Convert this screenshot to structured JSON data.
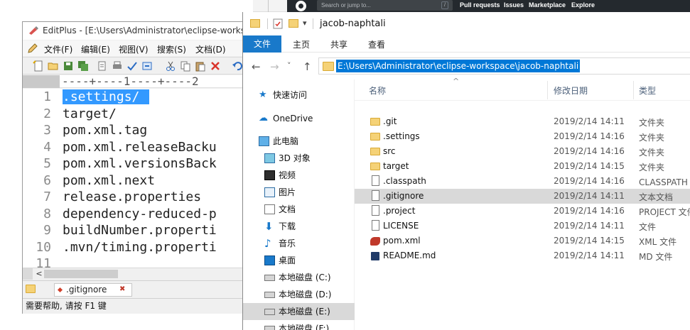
{
  "github": {
    "search_placeholder": "Search or jump to...",
    "slash_key": "/",
    "nav": [
      "Pull requests",
      "Issues",
      "Marketplace",
      "Explore"
    ]
  },
  "editplus": {
    "title": "EditPlus - [E:\\Users\\Administrator\\eclipse-worksp",
    "menu": [
      "文件(F)",
      "编辑(E)",
      "视图(V)",
      "搜索(S)",
      "文档(D)"
    ],
    "ruler": "----+----1----+----2",
    "lines": [
      {
        "num": "1",
        "text": ".settings/",
        "selected": true
      },
      {
        "num": "2",
        "text": "target/"
      },
      {
        "num": "3",
        "text": "pom.xml.tag"
      },
      {
        "num": "4",
        "text": "pom.xml.releaseBacku"
      },
      {
        "num": "5",
        "text": "pom.xml.versionsBack"
      },
      {
        "num": "6",
        "text": "pom.xml.next"
      },
      {
        "num": "7",
        "text": "release.properties"
      },
      {
        "num": "8",
        "text": "dependency-reduced-p"
      },
      {
        "num": "9",
        "text": "buildNumber.properti"
      },
      {
        "num": "10",
        "text": ".mvn/timing.properti"
      },
      {
        "num": "11",
        "text": ""
      }
    ],
    "scroll_left": "<",
    "tab_label": ".gitignore",
    "status": "需要帮助, 请按 F1 键"
  },
  "explorer": {
    "title": "jacob-naphtali",
    "ribbon": {
      "file": "文件",
      "tabs": [
        "主页",
        "共享",
        "查看"
      ]
    },
    "nav_buttons": [
      "←",
      "→",
      "˅",
      "↑"
    ],
    "address": "E:\\Users\\Administrator\\eclipse-workspace\\jacob-naphtali",
    "sidebar": [
      {
        "label": "快速访问",
        "icon": "star-icon"
      },
      {
        "label": "OneDrive",
        "icon": "cloud-icon"
      },
      {
        "label": "此电脑",
        "icon": "computer-icon"
      },
      {
        "label": "3D 对象",
        "icon": "cube-icon"
      },
      {
        "label": "视频",
        "icon": "video-icon"
      },
      {
        "label": "图片",
        "icon": "picture-icon"
      },
      {
        "label": "文档",
        "icon": "document-icon"
      },
      {
        "label": "下载",
        "icon": "download-icon"
      },
      {
        "label": "音乐",
        "icon": "music-icon"
      },
      {
        "label": "桌面",
        "icon": "desktop-icon"
      },
      {
        "label": "本地磁盘 (C:)",
        "icon": "drive-icon"
      },
      {
        "label": "本地磁盘 (D:)",
        "icon": "drive-icon"
      },
      {
        "label": "本地磁盘 (E:)",
        "icon": "drive-icon"
      },
      {
        "label": "本地磁盘 (F:)",
        "icon": "drive-icon"
      }
    ],
    "columns": {
      "name": "名称",
      "date": "修改日期",
      "type": "类型"
    },
    "files": [
      {
        "name": ".git",
        "date": "2019/2/14 14:11",
        "type": "文件夹",
        "icon": "folder-icon"
      },
      {
        "name": ".settings",
        "date": "2019/2/14 14:16",
        "type": "文件夹",
        "icon": "folder-icon"
      },
      {
        "name": "src",
        "date": "2019/2/14 14:16",
        "type": "文件夹",
        "icon": "folder-icon"
      },
      {
        "name": "target",
        "date": "2019/2/14 14:15",
        "type": "文件夹",
        "icon": "folder-icon"
      },
      {
        "name": ".classpath",
        "date": "2019/2/14 14:16",
        "type": "CLASSPATH 文",
        "icon": "file-icon"
      },
      {
        "name": ".gitignore",
        "date": "2019/2/14 14:11",
        "type": "文本文档",
        "icon": "file-icon",
        "selected": true
      },
      {
        "name": ".project",
        "date": "2019/2/14 14:16",
        "type": "PROJECT 文件",
        "icon": "file-icon"
      },
      {
        "name": "LICENSE",
        "date": "2019/2/14 14:11",
        "type": "文件",
        "icon": "file-icon"
      },
      {
        "name": "pom.xml",
        "date": "2019/2/14 14:15",
        "type": "XML 文件",
        "icon": "xml-file-icon"
      },
      {
        "name": "README.md",
        "date": "2019/2/14 14:11",
        "type": "MD 文件",
        "icon": "markdown-file-icon"
      }
    ]
  }
}
